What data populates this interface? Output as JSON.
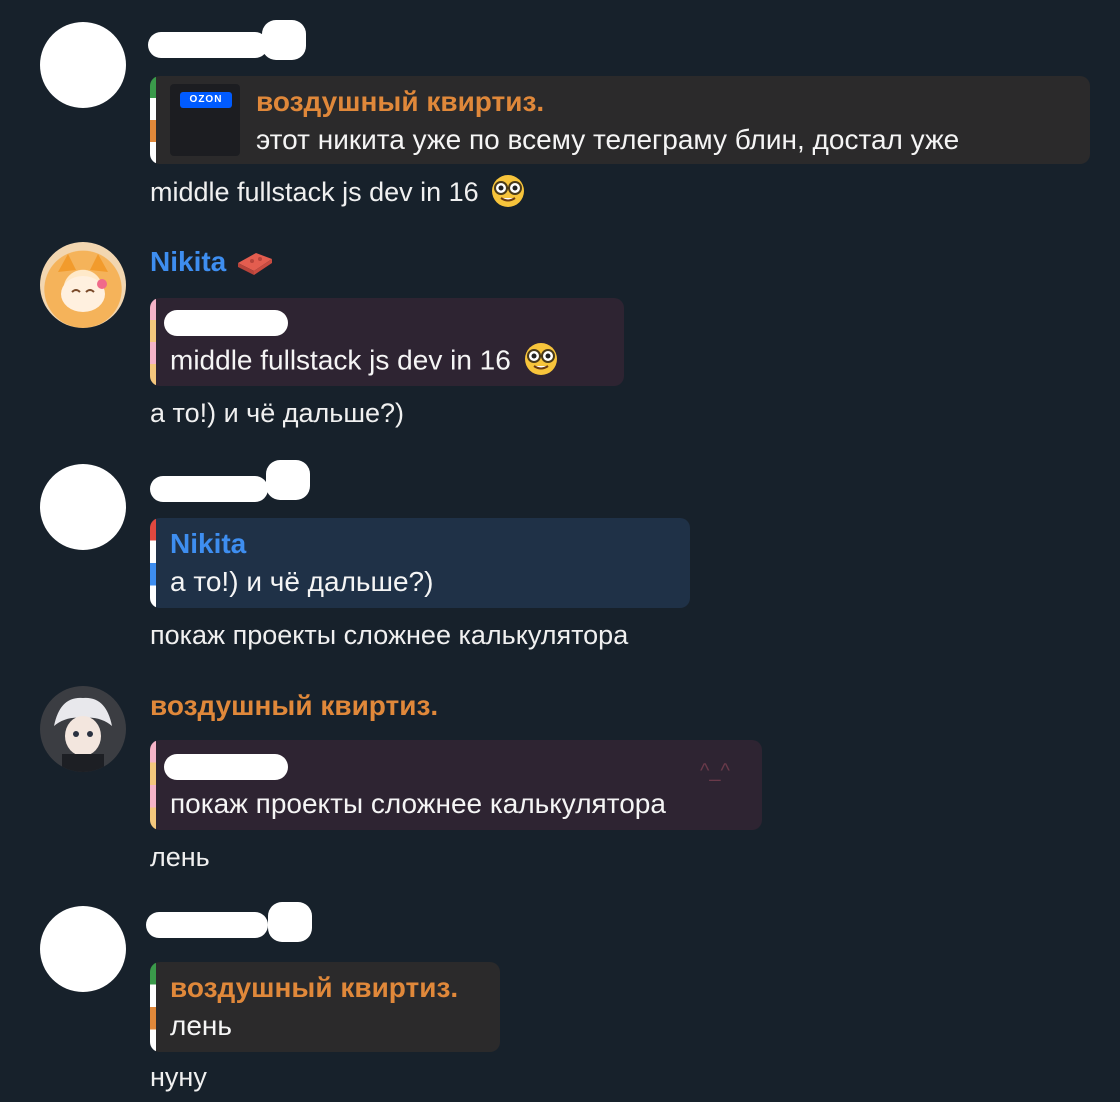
{
  "colors": {
    "background": "#17212b",
    "orange_name": "#e0883a",
    "blue_name": "#3e8ef0",
    "quote_bg_brown": "#2b2a2b",
    "quote_bg_purple": "#2e2432",
    "quote_bg_blue": "#1f3147"
  },
  "messages": [
    {
      "avatar": "hidden-avatar",
      "reply": {
        "author": "воздушный квиртиз.",
        "text": "этот никита уже по всему телеграму блин, достал уже",
        "thumbnail_label": "OZON"
      },
      "text": "middle fullstack js dev in 16",
      "emoji": "nerd-face-emoji"
    },
    {
      "author": "Nikita",
      "author_emoji": "brick-emoji",
      "reply": {
        "text": "middle fullstack js dev in 16",
        "emoji": "nerd-face-emoji"
      },
      "text": "а то!) и чё дальше?)"
    },
    {
      "avatar": "hidden-avatar",
      "reply": {
        "author": "Nikita",
        "text": "а то!) и чё дальше?)"
      },
      "text": "покаж проекты сложнее калькулятора"
    },
    {
      "author": "воздушный квиртиз.",
      "reply": {
        "text": "покаж проекты сложнее калькулятора",
        "decoration": "^_^"
      },
      "text": "лень"
    },
    {
      "avatar": "hidden-avatar",
      "reply": {
        "author": "воздушный квиртиз.",
        "text": "лень"
      },
      "text": "нуну"
    }
  ]
}
